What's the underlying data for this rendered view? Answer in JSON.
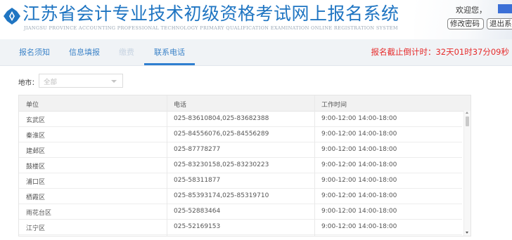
{
  "header": {
    "title_cn": "江苏省会计专业技术初级资格考试网上报名系统",
    "title_en": "JIANGSU PROVINCE ACCOUNTING PROFESSIONAL TECHNOLOGY PRIMARY QUALIFICATION EXAMINATION ONLINE REGISTRATION SYSTEM",
    "logo_icon": "jiangsu-logo-icon",
    "welcome": "欢迎您，",
    "change_password": "修改密码",
    "logout": "退出系统",
    "accent": "#1f75c2"
  },
  "nav": {
    "tabs": [
      {
        "label": "报名须知"
      },
      {
        "label": "信息填报"
      },
      {
        "label": "缴费"
      },
      {
        "label": "联系电话"
      }
    ],
    "active_tab": "联系电话",
    "countdown": "报名截止倒计时：32天01时37分09秒",
    "countdown_color": "#e62b2b"
  },
  "filter": {
    "label": "地市：",
    "selected": "全部"
  },
  "table": {
    "headers": [
      "单位",
      "电话",
      "工作时间"
    ],
    "rows": [
      [
        "玄武区",
        "025-83610804,025-83682388",
        "9:00-12:00 14:00-18:00"
      ],
      [
        "秦淮区",
        "025-84556076,025-84556289",
        "9:00-12:00 14:00-18:00"
      ],
      [
        "建邺区",
        "025-87778277",
        "9:00-12:00 14:00-18:00"
      ],
      [
        "鼓楼区",
        "025-83230158,025-83230223",
        "9:00-12:00 14:00-18:00"
      ],
      [
        "浦口区",
        "025-58311877",
        "9:00-12:00 14:00-18:00"
      ],
      [
        "栖霞区",
        "025-85393174,025-85319710",
        "9:00-12:00 14:00-18:00"
      ],
      [
        "雨花台区",
        "025-52883464",
        "9:00-12:00 14:00-18:00"
      ],
      [
        "江宁区",
        "025-52169153",
        "9:00-12:00 14:00-18:00"
      ]
    ]
  }
}
